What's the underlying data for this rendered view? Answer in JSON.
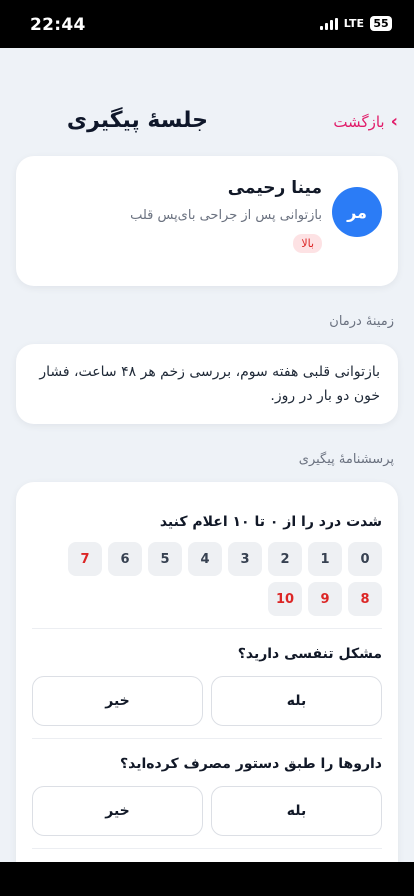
{
  "status": {
    "time": "22:44",
    "network": "LTE",
    "battery": "55"
  },
  "header": {
    "back_label": "بازگشت",
    "title": "جلسهٔ پیگیری"
  },
  "patient": {
    "initials": "مر",
    "name": "مینا رحیمی",
    "description": "بازتوانی پس از جراحی بای‌پس قلب",
    "priority": "بالا"
  },
  "context": {
    "label": "زمینهٔ درمان",
    "text": "بازتوانی قلبی هفته سوم، بررسی زخم هر ۴۸ ساعت، فشار خون دو بار در روز."
  },
  "questionnaire": {
    "label": "پرسشنامهٔ پیگیری",
    "pain_question": "شدت درد را از ۰ تا ۱۰ اعلام کنید",
    "pain_scale": [
      "0",
      "1",
      "2",
      "3",
      "4",
      "5",
      "6",
      "7",
      "8",
      "9",
      "10"
    ],
    "breathing_question": "مشکل تنفسی دارید؟",
    "medication_question": "داروها را طبق دستور مصرف کرده‌اید؟",
    "yes_label": "بله",
    "no_label": "خیر"
  },
  "colors": {
    "accent": "#e11d6a",
    "avatar": "#2b7cf6",
    "danger": "#dc2626"
  }
}
